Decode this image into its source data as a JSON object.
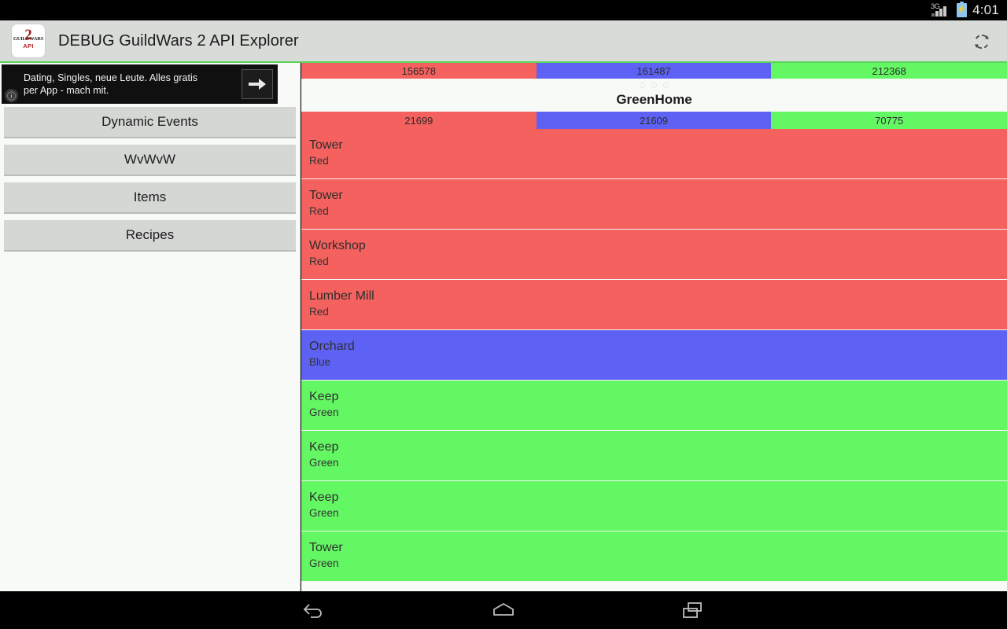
{
  "statusbar": {
    "network_label": "3G",
    "signal_icon": "signal-bars-icon",
    "battery_icon": "battery-charging-icon",
    "battery_glyph": "⚡",
    "clock": "4:01"
  },
  "actionbar": {
    "app_icon": "guildwars2-api-app-icon",
    "icon_brand_text": "GUILDWARS",
    "icon_dragon_glyph": "2",
    "icon_api_text": "API",
    "title": "DEBUG GuildWars 2 API Explorer",
    "refresh_icon": "refresh-icon",
    "accent_color": "#5ad45a"
  },
  "ad": {
    "info_icon": "info-icon",
    "info_glyph": "ⓘ",
    "text": "Dating, Singles, neue Leute. Alles gratis per App - mach mit.",
    "arrow_icon": "arrow-right-icon"
  },
  "sidebar": {
    "items": [
      {
        "label": "Dynamic Events"
      },
      {
        "label": "WvWvW"
      },
      {
        "label": "Items"
      },
      {
        "label": "Recipes"
      }
    ]
  },
  "main": {
    "match_title": "GreenHome",
    "page_dots": 3,
    "colors": {
      "red": "#f4615e",
      "blue": "#5d62f5",
      "green": "#64f764",
      "divider": "#f2f6f2",
      "background": "#f7faf7"
    },
    "score_bars": [
      {
        "name": "total-score-bar",
        "segments": [
          {
            "team": "Red",
            "value": "156578",
            "color": "#f4615e",
            "width_pct": 33.3
          },
          {
            "team": "Blue",
            "value": "161487",
            "color": "#5d62f5",
            "width_pct": 33.3
          },
          {
            "team": "Green",
            "value": "212368",
            "color": "#64f764",
            "width_pct": 33.4
          }
        ]
      },
      {
        "name": "map-score-bar",
        "segments": [
          {
            "team": "Red",
            "value": "21699",
            "color": "#f4615e",
            "width_pct": 33.3
          },
          {
            "team": "Blue",
            "value": "21609",
            "color": "#5d62f5",
            "width_pct": 33.3
          },
          {
            "team": "Green",
            "value": "70775",
            "color": "#64f764",
            "width_pct": 33.4
          }
        ]
      }
    ],
    "objectives": [
      {
        "name": "Tower",
        "team": "Red",
        "color": "#f4615e"
      },
      {
        "name": "Tower",
        "team": "Red",
        "color": "#f4615e"
      },
      {
        "name": "Workshop",
        "team": "Red",
        "color": "#f4615e"
      },
      {
        "name": "Lumber Mill",
        "team": "Red",
        "color": "#f4615e"
      },
      {
        "name": "Orchard",
        "team": "Blue",
        "color": "#5d62f5"
      },
      {
        "name": "Keep",
        "team": "Green",
        "color": "#64f764"
      },
      {
        "name": "Keep",
        "team": "Green",
        "color": "#64f764"
      },
      {
        "name": "Keep",
        "team": "Green",
        "color": "#64f764"
      },
      {
        "name": "Tower",
        "team": "Green",
        "color": "#64f764"
      }
    ]
  },
  "navbar": {
    "keys": [
      {
        "name": "back-icon"
      },
      {
        "name": "home-icon"
      },
      {
        "name": "recents-icon"
      }
    ]
  }
}
